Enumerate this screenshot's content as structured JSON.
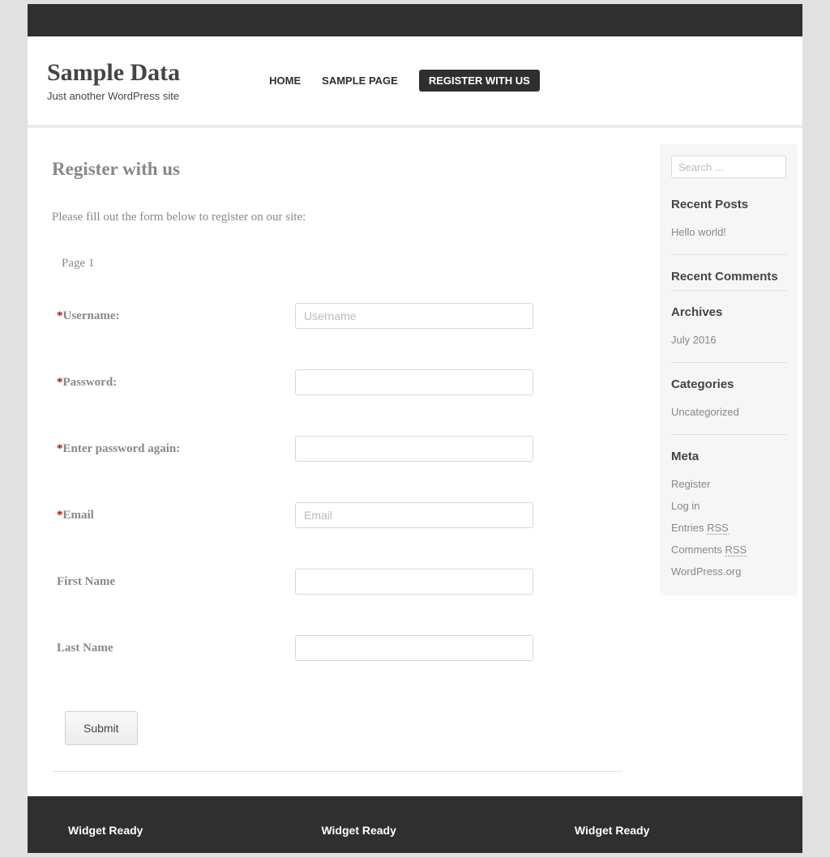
{
  "header": {
    "site_title": "Sample Data",
    "site_tagline": "Just another WordPress site",
    "nav": [
      {
        "label": "HOME",
        "active": false
      },
      {
        "label": "SAMPLE PAGE",
        "active": false
      },
      {
        "label": "REGISTER WITH US",
        "active": true
      }
    ]
  },
  "main": {
    "page_title": "Register with us",
    "intro": "Please fill out the form below to register on our site:",
    "page_indicator": "Page 1",
    "fields": {
      "username": {
        "label": "Username",
        "placeholder": "Username",
        "required": true,
        "colon": ":"
      },
      "password": {
        "label": "Password",
        "placeholder": "",
        "required": true,
        "colon": ":"
      },
      "password_confirm": {
        "label": "Enter password again",
        "placeholder": "",
        "required": true,
        "colon": ":"
      },
      "email": {
        "label": "Email",
        "placeholder": "Email",
        "required": true,
        "colon": ""
      },
      "first_name": {
        "label": "First Name",
        "placeholder": "",
        "required": false,
        "colon": ""
      },
      "last_name": {
        "label": "Last Name",
        "placeholder": "",
        "required": false,
        "colon": ""
      }
    },
    "submit_label": "Submit"
  },
  "sidebar": {
    "search_placeholder": "Search ...",
    "recent_posts": {
      "title": "Recent Posts",
      "items": [
        {
          "label": "Hello world!"
        }
      ]
    },
    "recent_comments": {
      "title": "Recent Comments"
    },
    "archives": {
      "title": "Archives",
      "items": [
        {
          "label": "July 2016"
        }
      ]
    },
    "categories": {
      "title": "Categories",
      "items": [
        {
          "label": "Uncategorized"
        }
      ]
    },
    "meta": {
      "title": "Meta",
      "items": {
        "register": "Register",
        "login": "Log in",
        "entries_prefix": "Entries ",
        "entries_rss": "RSS",
        "comments_prefix": "Comments ",
        "comments_rss": "RSS",
        "wordpress": "WordPress.org"
      }
    }
  },
  "footer": {
    "col1": "Widget Ready",
    "col2": "Widget Ready",
    "col3": "Widget Ready"
  }
}
